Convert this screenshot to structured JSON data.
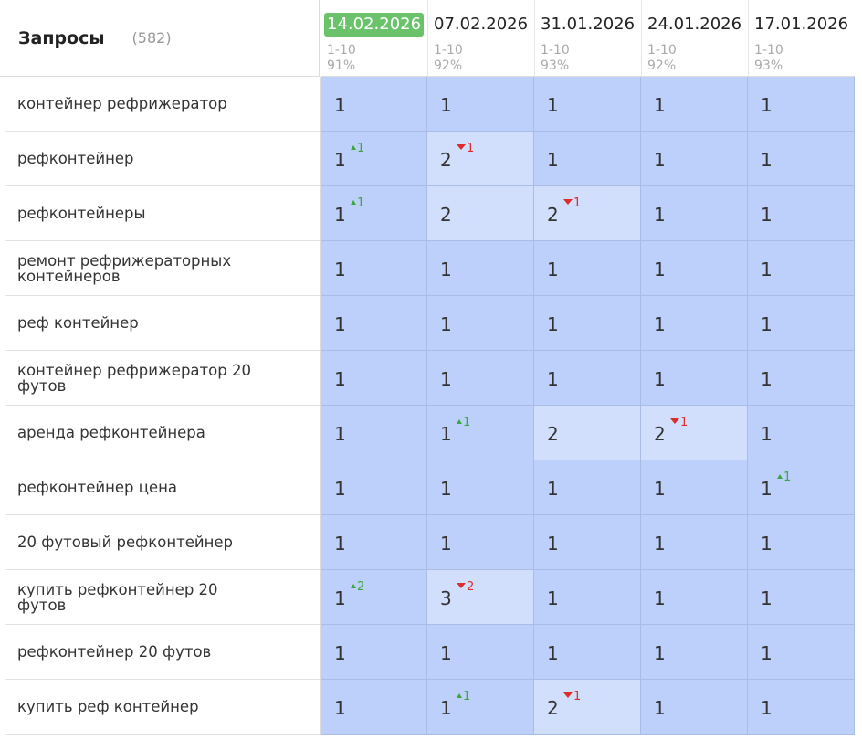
{
  "header": {
    "title": "Запросы",
    "count": "(582)"
  },
  "dates": [
    {
      "label": "14.02.2026",
      "range": "1-10",
      "pct": "91%",
      "current": true
    },
    {
      "label": "07.02.2026",
      "range": "1-10",
      "pct": "92%",
      "current": false
    },
    {
      "label": "31.01.2026",
      "range": "1-10",
      "pct": "93%",
      "current": false
    },
    {
      "label": "24.01.2026",
      "range": "1-10",
      "pct": "92%",
      "current": false
    },
    {
      "label": "17.01.2026",
      "range": "1-10",
      "pct": "93%",
      "current": false
    }
  ],
  "rows": [
    {
      "query": "контейнер рефрижератор",
      "cells": [
        {
          "v": "1"
        },
        {
          "v": "1"
        },
        {
          "v": "1"
        },
        {
          "v": "1"
        },
        {
          "v": "1"
        }
      ]
    },
    {
      "query": "рефконтейнер",
      "cells": [
        {
          "v": "1",
          "d": "1",
          "dir": "up"
        },
        {
          "v": "2",
          "d": "1",
          "dir": "down"
        },
        {
          "v": "1"
        },
        {
          "v": "1"
        },
        {
          "v": "1"
        }
      ]
    },
    {
      "query": "рефконтейнеры",
      "cells": [
        {
          "v": "1",
          "d": "1",
          "dir": "up"
        },
        {
          "v": "2"
        },
        {
          "v": "2",
          "d": "1",
          "dir": "down"
        },
        {
          "v": "1"
        },
        {
          "v": "1"
        }
      ]
    },
    {
      "query": "ремонт рефрижераторных контейнеров",
      "cells": [
        {
          "v": "1"
        },
        {
          "v": "1"
        },
        {
          "v": "1"
        },
        {
          "v": "1"
        },
        {
          "v": "1"
        }
      ]
    },
    {
      "query": "реф контейнер",
      "cells": [
        {
          "v": "1"
        },
        {
          "v": "1"
        },
        {
          "v": "1"
        },
        {
          "v": "1"
        },
        {
          "v": "1"
        }
      ]
    },
    {
      "query": "контейнер рефрижератор 20 футов",
      "cells": [
        {
          "v": "1"
        },
        {
          "v": "1"
        },
        {
          "v": "1"
        },
        {
          "v": "1"
        },
        {
          "v": "1"
        }
      ]
    },
    {
      "query": "аренда рефконтейнера",
      "cells": [
        {
          "v": "1"
        },
        {
          "v": "1",
          "d": "1",
          "dir": "up"
        },
        {
          "v": "2"
        },
        {
          "v": "2",
          "d": "1",
          "dir": "down"
        },
        {
          "v": "1"
        }
      ]
    },
    {
      "query": "рефконтейнер цена",
      "cells": [
        {
          "v": "1"
        },
        {
          "v": "1"
        },
        {
          "v": "1"
        },
        {
          "v": "1"
        },
        {
          "v": "1",
          "d": "1",
          "dir": "up"
        }
      ]
    },
    {
      "query": "20 футовый рефконтейнер",
      "cells": [
        {
          "v": "1"
        },
        {
          "v": "1"
        },
        {
          "v": "1"
        },
        {
          "v": "1"
        },
        {
          "v": "1"
        }
      ]
    },
    {
      "query": "купить рефконтейнер 20 футов",
      "cells": [
        {
          "v": "1",
          "d": "2",
          "dir": "up"
        },
        {
          "v": "3",
          "d": "2",
          "dir": "down"
        },
        {
          "v": "1"
        },
        {
          "v": "1"
        },
        {
          "v": "1"
        }
      ]
    },
    {
      "query": "рефконтейнер 20 футов",
      "cells": [
        {
          "v": "1"
        },
        {
          "v": "1"
        },
        {
          "v": "1"
        },
        {
          "v": "1"
        },
        {
          "v": "1"
        }
      ]
    },
    {
      "query": "купить реф контейнер",
      "cells": [
        {
          "v": "1"
        },
        {
          "v": "1",
          "d": "1",
          "dir": "up"
        },
        {
          "v": "2",
          "d": "1",
          "dir": "down"
        },
        {
          "v": "1"
        },
        {
          "v": "1"
        }
      ]
    }
  ]
}
